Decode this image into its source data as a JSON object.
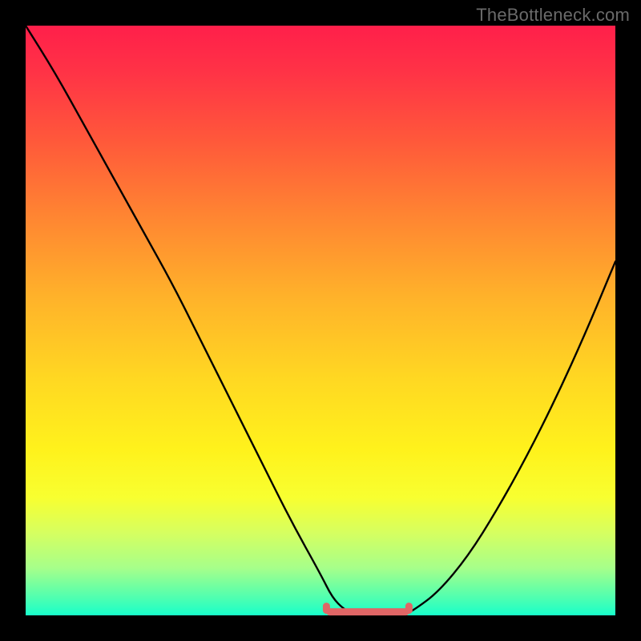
{
  "watermark": "TheBottleneck.com",
  "colors": {
    "frame": "#000000",
    "curve": "#000000",
    "bottom_accent": "#e06666"
  },
  "chart_data": {
    "type": "line",
    "title": "",
    "xlabel": "",
    "ylabel": "",
    "xlim": [
      0,
      100
    ],
    "ylim": [
      0,
      100
    ],
    "categories": [
      0,
      5,
      10,
      15,
      20,
      25,
      30,
      35,
      40,
      45,
      50,
      52,
      54,
      56,
      58,
      60,
      62,
      64,
      66,
      70,
      75,
      80,
      85,
      90,
      95,
      100
    ],
    "series": [
      {
        "name": "bottleneck-curve",
        "values": [
          100,
          92,
          83,
          74,
          65,
          56,
          46,
          36,
          26,
          16,
          7,
          3,
          1,
          0,
          0,
          0,
          0,
          0,
          1,
          4,
          10,
          18,
          27,
          37,
          48,
          60
        ]
      }
    ],
    "bottom_marker": {
      "x_start": 51,
      "x_end": 65,
      "y": 1
    }
  }
}
